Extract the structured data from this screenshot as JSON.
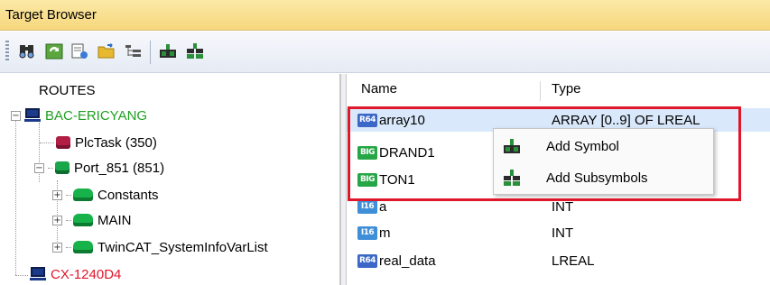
{
  "window": {
    "title": "Target Browser"
  },
  "toolbar": {
    "buttons": [
      {
        "icon": "find-icon"
      },
      {
        "icon": "refresh-icon"
      },
      {
        "icon": "properties-icon"
      },
      {
        "icon": "open-folder-icon"
      },
      {
        "icon": "hierarchy-icon"
      },
      {
        "icon": "add-symbol-icon"
      },
      {
        "icon": "add-subsymbols-icon"
      }
    ]
  },
  "tree": {
    "root": "ROUTES",
    "items": [
      {
        "label": "BAC-ERICYANG",
        "color": "#20a020"
      },
      {
        "label": "PlcTask (350)"
      },
      {
        "label": "Port_851 (851)"
      },
      {
        "label": "Constants"
      },
      {
        "label": "MAIN"
      },
      {
        "label": "TwinCAT_SystemInfoVarList"
      },
      {
        "label": "CX-1240D4",
        "color": "#e0162b"
      }
    ]
  },
  "list": {
    "columns": [
      "Name",
      "Type"
    ],
    "rows": [
      {
        "badge": "R64",
        "name": "array10",
        "type": "ARRAY [0..9] OF LREAL"
      },
      {
        "badge": "BIG",
        "name": "DRAND1",
        "type": ""
      },
      {
        "badge": "BIG",
        "name": "TON1",
        "type": ""
      },
      {
        "badge": "I16",
        "name": "a",
        "type": "INT"
      },
      {
        "badge": "I16",
        "name": "m",
        "type": "INT"
      },
      {
        "badge": "R64",
        "name": "real_data",
        "type": "LREAL"
      }
    ]
  },
  "context_menu": {
    "items": [
      {
        "label": "Add Symbol",
        "icon": "add-symbol-icon"
      },
      {
        "label": "Add Subsymbols",
        "icon": "add-subsymbols-icon"
      }
    ]
  },
  "colors": {
    "highlight_box": "#e0162b",
    "title_bar": "#f6d77d",
    "selection": "#d9e9fb"
  }
}
